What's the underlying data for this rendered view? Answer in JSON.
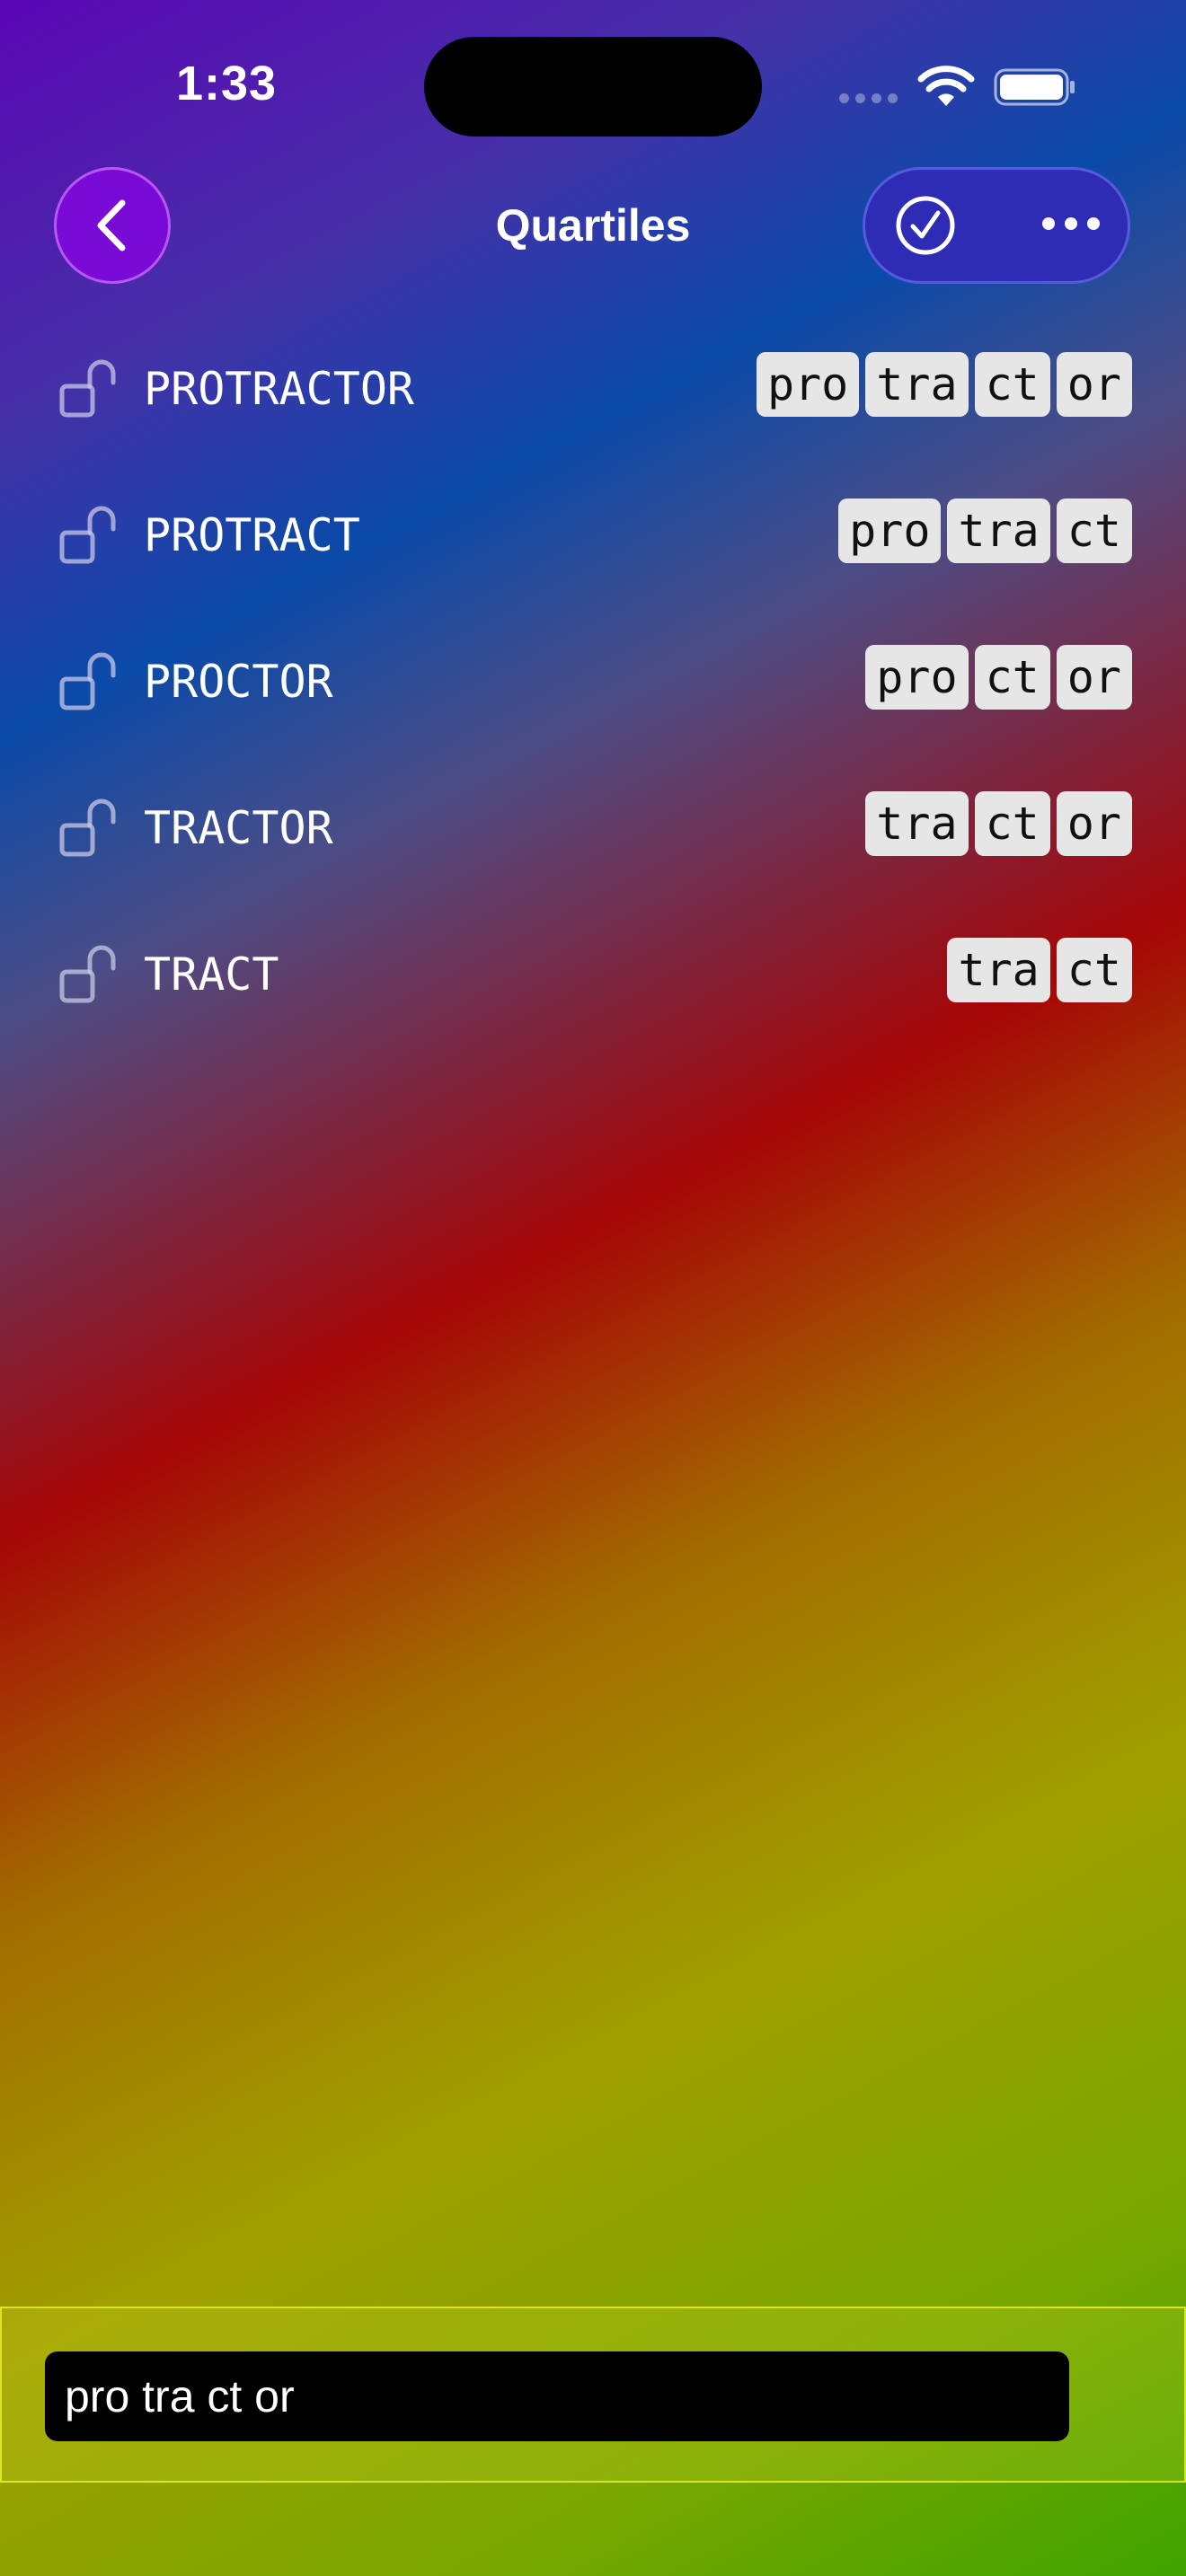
{
  "status_bar": {
    "time": "1:33"
  },
  "nav": {
    "title": "Quartiles"
  },
  "words": [
    {
      "word": "PROTRACTOR",
      "tiles": [
        "pro",
        "tra",
        "ct",
        "or"
      ]
    },
    {
      "word": "PROTRACT",
      "tiles": [
        "pro",
        "tra",
        "ct"
      ]
    },
    {
      "word": "PROCTOR",
      "tiles": [
        "pro",
        "ct",
        "or"
      ]
    },
    {
      "word": "TRACTOR",
      "tiles": [
        "tra",
        "ct",
        "or"
      ]
    },
    {
      "word": "TRACT",
      "tiles": [
        "tra",
        "ct"
      ]
    }
  ],
  "input": {
    "value": "pro tra ct or"
  },
  "icons": {
    "back": "chevron-left-icon",
    "check": "checkmark-circle-icon",
    "more": "ellipsis-icon",
    "lock": "lock-open-icon"
  }
}
